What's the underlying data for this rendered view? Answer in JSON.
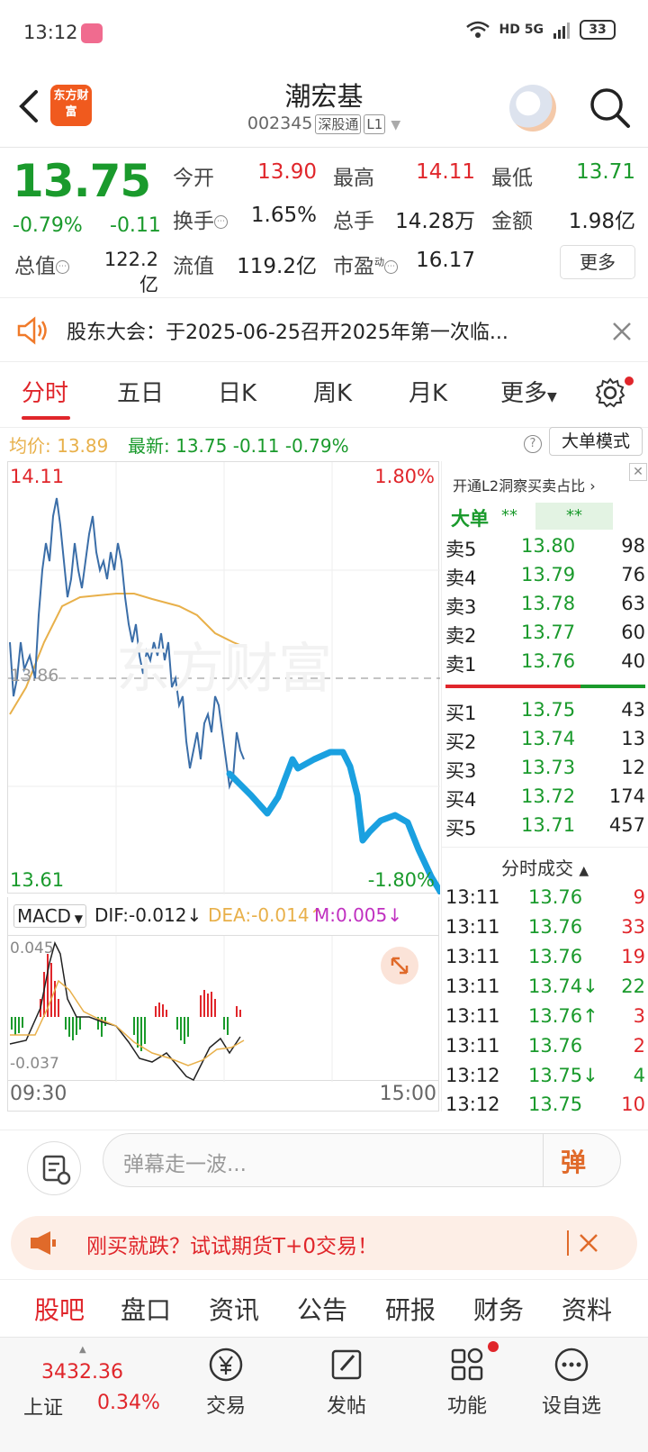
{
  "status_bar": {
    "time": "13:12",
    "network": "HD 5G",
    "battery": "33"
  },
  "header": {
    "logo_text": "东方财富",
    "stock_name": "潮宏基",
    "stock_code": "002345",
    "tag1": "深股通",
    "tag2": "L1"
  },
  "quote": {
    "price": "13.75",
    "change_pct": "-0.79%",
    "change_amt": "-0.11",
    "open_label": "今开",
    "open": "13.90",
    "high_label": "最高",
    "high": "14.11",
    "low_label": "最低",
    "low": "13.71",
    "turnover_label": "换手",
    "turnover": "1.65%",
    "volume_label": "总手",
    "volume": "14.28万",
    "amount_label": "金额",
    "amount": "1.98亿",
    "mktcap_label": "总值",
    "mktcap": "122.2亿",
    "float_label": "流值",
    "float": "119.2亿",
    "pe_label": "市盈",
    "pe_sup": "动",
    "pe": "16.17",
    "more": "更多"
  },
  "notice": {
    "text": "股东大会：于2025-06-25召开2025年第一次临..."
  },
  "tabs": [
    "分时",
    "五日",
    "日K",
    "周K",
    "月K",
    "更多"
  ],
  "avg_line": {
    "avg_label": "均价:",
    "avg": "13.89",
    "latest_label": "最新:",
    "latest": "13.75",
    "chg": "-0.11",
    "pct": "-0.79%",
    "big_mode": "大单模式"
  },
  "chart": {
    "top_price": "14.11",
    "top_pct": "1.80%",
    "bottom_price": "13.61",
    "bottom_pct": "-1.80%",
    "mid_price": "13.86",
    "watermark": "东方财富",
    "time_start": "09:30",
    "time_end": "15:00"
  },
  "macd": {
    "name": "MACD",
    "dif": "DIF:-0.012↓",
    "dea": "DEA:-0.014↑",
    "m": "M:0.005↓",
    "top": "0.045",
    "bottom": "-0.037"
  },
  "orderbook": {
    "header": "开通L2洞察买卖占比",
    "big_label": "大单",
    "big_v1": "**",
    "big_v2": "**",
    "asks": [
      {
        "label": "卖5",
        "price": "13.80",
        "vol": "98"
      },
      {
        "label": "卖4",
        "price": "13.79",
        "vol": "76"
      },
      {
        "label": "卖3",
        "price": "13.78",
        "vol": "63"
      },
      {
        "label": "卖2",
        "price": "13.77",
        "vol": "60"
      },
      {
        "label": "卖1",
        "price": "13.76",
        "vol": "40"
      }
    ],
    "bids": [
      {
        "label": "买1",
        "price": "13.75",
        "vol": "43"
      },
      {
        "label": "买2",
        "price": "13.74",
        "vol": "13"
      },
      {
        "label": "买3",
        "price": "13.73",
        "vol": "12"
      },
      {
        "label": "买4",
        "price": "13.72",
        "vol": "174"
      },
      {
        "label": "买5",
        "price": "13.71",
        "vol": "457"
      }
    ],
    "trades_header": "分时成交",
    "trades": [
      {
        "time": "13:11",
        "price": "13.76",
        "vol": "9"
      },
      {
        "time": "13:11",
        "price": "13.76",
        "vol": "33"
      },
      {
        "time": "13:11",
        "price": "13.76",
        "vol": "19"
      },
      {
        "time": "13:11",
        "price": "13.74↓",
        "vol": "22"
      },
      {
        "time": "13:11",
        "price": "13.76↑",
        "vol": "3"
      },
      {
        "time": "13:11",
        "price": "13.76",
        "vol": "2"
      },
      {
        "time": "13:12",
        "price": "13.75↓",
        "vol": "4"
      },
      {
        "time": "13:12",
        "price": "13.75",
        "vol": "10"
      }
    ]
  },
  "danmu": {
    "placeholder": "弹幕走一波...",
    "button": "弹"
  },
  "ad": {
    "text": "刚买就跌？试试期货T+0交易！"
  },
  "bottom_tabs": [
    "股吧",
    "盘口",
    "资讯",
    "公告",
    "研报",
    "财务",
    "资料"
  ],
  "bottom_nav": {
    "index_name": "上证",
    "index_value": "3432.36",
    "index_pct": "0.34%",
    "trade": "交易",
    "post": "发帖",
    "functions": "功能",
    "watchlist": "设自选"
  },
  "colors": {
    "up": "#e0262b",
    "down": "#1a9a2c",
    "avg": "#e8b04a",
    "price_line": "#3b6ea8",
    "drawing": "#1aa0e0"
  }
}
